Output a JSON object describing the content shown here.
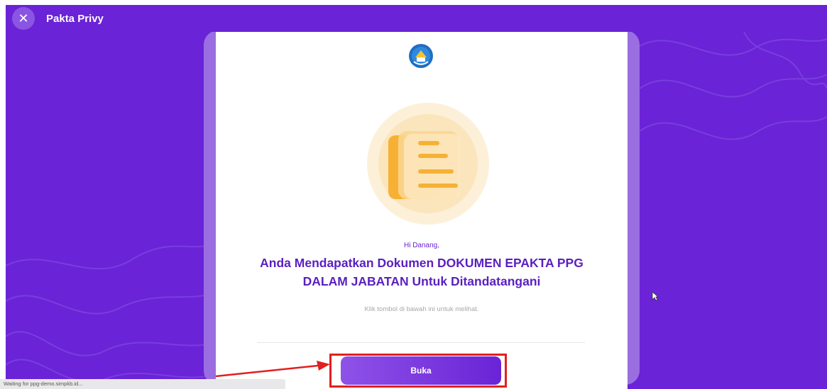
{
  "window": {
    "title": "Pakta Privy",
    "close_glyph": "✕"
  },
  "card": {
    "logo_icon": "tut-wuri-handayani-logo-icon",
    "illustration_icon": "document-icon",
    "greeting": "Hi Danang,",
    "headline": "Anda Mendapatkan Dokumen DOKUMEN EPAKTA PPG DALAM JABATAN Untuk Ditandatangani",
    "hint": "Klik tombol di bawah ini untuk melihat.",
    "open_button_label": "Buka"
  },
  "status_bar": {
    "text": "Waiting for ppg-demo.simpkb.id..."
  },
  "colors": {
    "primary": "#6a23d6",
    "headline": "#5a1fc0",
    "annotation": "#e02020",
    "illustration_bg": "#fdf0d8",
    "illustration_accent": "#f6b135"
  }
}
